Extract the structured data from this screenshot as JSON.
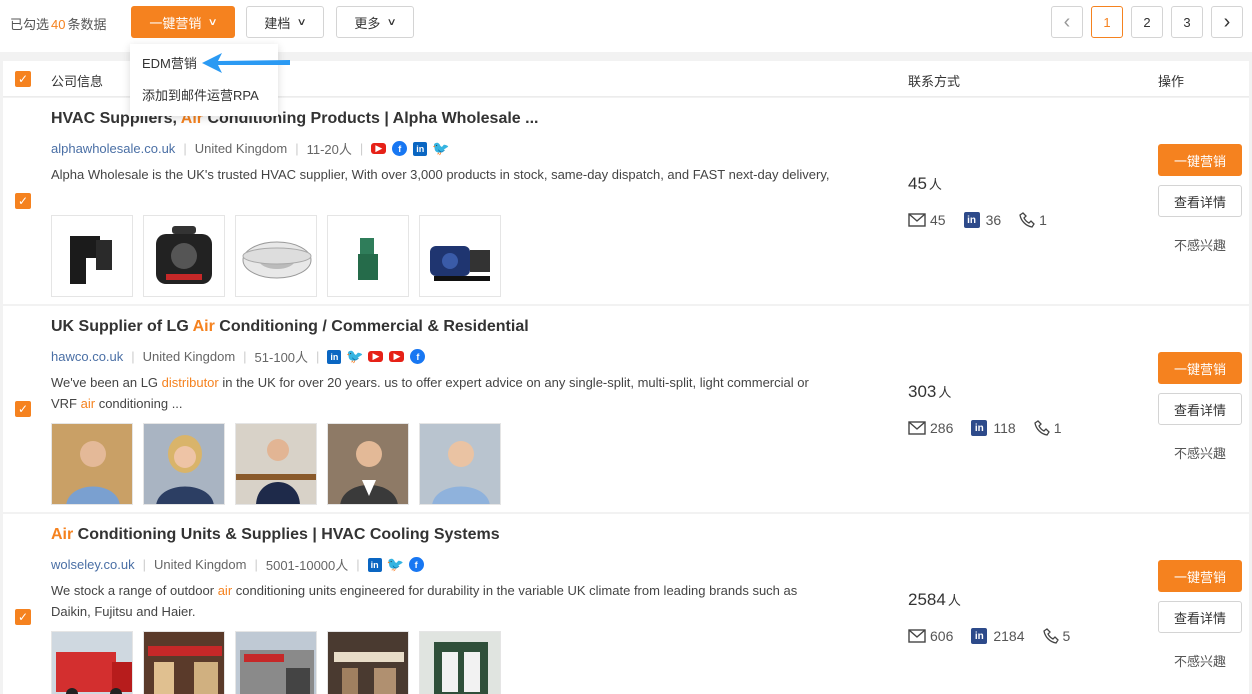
{
  "toolbar": {
    "selected_prefix": "已勾选",
    "selected_count": "40",
    "selected_suffix": "条数据",
    "one_click_marketing": "一键营销",
    "archive": "建档",
    "more": "更多"
  },
  "pagination": {
    "pages": [
      "1",
      "2",
      "3"
    ],
    "active": "1"
  },
  "dropdown": {
    "items": [
      "EDM营销",
      "添加到邮件运营RPA"
    ]
  },
  "table_header": {
    "company_info": "公司信息",
    "contact": "联系方式",
    "actions": "操作"
  },
  "companies": [
    {
      "title_pre": "HVAC Suppliers, ",
      "title_hl": "Air",
      "title_post": " Conditioning Products | Alpha Wholesale ...",
      "domain": "alphawholesale.co.uk",
      "country": "United Kingdom",
      "size": "11-20人",
      "socials": [
        "youtube",
        "facebook",
        "linkedin",
        "twitter"
      ],
      "desc_a": "Alpha Wholesale is the UK's trusted HVAC supplier, With over 3,000 products in stock, same-day dispatch, and FAST next-day delivery,",
      "desc_hl": "",
      "desc_b": "",
      "desc_hl2": "",
      "desc_c": "",
      "contact_total": "45",
      "unit": "人",
      "emails": "45",
      "linkedin": "36",
      "phones": "1",
      "thumbs": [
        "product-fitting",
        "product-machine",
        "product-cassette",
        "product-pipe",
        "product-pump"
      ]
    },
    {
      "title_pre": "UK Supplier of LG ",
      "title_hl": "Air",
      "title_post": " Conditioning / Commercial & Residential",
      "domain": "hawco.co.uk",
      "country": "United Kingdom",
      "size": "51-100人",
      "socials": [
        "linkedin",
        "twitter",
        "youtube",
        "youtube",
        "facebook"
      ],
      "desc_a": "We've been an LG ",
      "desc_hl": "distributor",
      "desc_b": " in the UK for over 20 years. us to offer expert advice on any single-split, multi-split, light commercial or VRF ",
      "desc_hl2": "air",
      "desc_c": " conditioning ...",
      "contact_total": "303",
      "unit": "人",
      "emails": "286",
      "linkedin": "118",
      "phones": "1",
      "thumbs": [
        "person-1",
        "person-2",
        "person-3",
        "person-4",
        "person-5"
      ]
    },
    {
      "title_pre": "",
      "title_hl": "Air",
      "title_post": " Conditioning Units & Supplies | HVAC Cooling Systems",
      "domain": "wolseley.co.uk",
      "country": "United Kingdom",
      "size": "5001-10000人",
      "socials": [
        "linkedin",
        "twitter",
        "facebook"
      ],
      "desc_a": "We stock a range of outdoor ",
      "desc_hl": "air",
      "desc_b": " conditioning units engineered for durability in the variable UK climate from leading brands such as Daikin, Fujitsu and Haier.",
      "desc_hl2": "",
      "desc_c": "",
      "contact_total": "2584",
      "unit": "人",
      "emails": "606",
      "linkedin": "2184",
      "phones": "5",
      "thumbs": [
        "photo-van",
        "photo-store",
        "photo-building",
        "photo-interior",
        "photo-showroom"
      ]
    }
  ],
  "actions": {
    "marketing": "一键营销",
    "details": "查看详情",
    "not_interested": "不感兴趣"
  },
  "colors": {
    "accent": "#f5821f",
    "link": "#4a6fa5",
    "annotation_arrow": "#2b9af3"
  }
}
